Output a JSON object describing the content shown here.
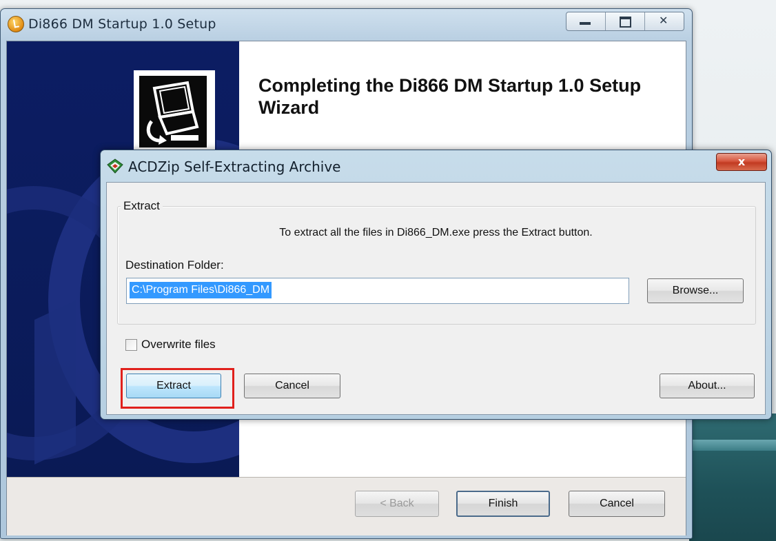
{
  "setup_window": {
    "title": "Di866 DM Startup 1.0 Setup",
    "heading": "Completing the Di866 DM Startup 1.0 Setup Wizard",
    "back_label": "< Back",
    "finish_label": "Finish",
    "cancel_label": "Cancel"
  },
  "zip_dialog": {
    "title": "ACDZip Self-Extracting Archive",
    "close_label": "x",
    "group_label": "Extract",
    "instruction": "To extract all the files in Di866_DM.exe press the Extract button.",
    "dest_label": "Destination Folder:",
    "dest_value": "C:\\Program Files\\Di866_DM",
    "browse_label": "Browse...",
    "overwrite_label": "Overwrite files",
    "overwrite_checked": false,
    "extract_label": "Extract",
    "cancel_label": "Cancel",
    "about_label": "About..."
  },
  "icons": {
    "setup_app": "installer-icon",
    "zip_app": "archive-icon",
    "wizard": "computer-install-icon"
  },
  "colors": {
    "banner": "#0c1d63",
    "selection": "#3399ff",
    "highlight": "#e0201c",
    "close": "#c23a22"
  }
}
